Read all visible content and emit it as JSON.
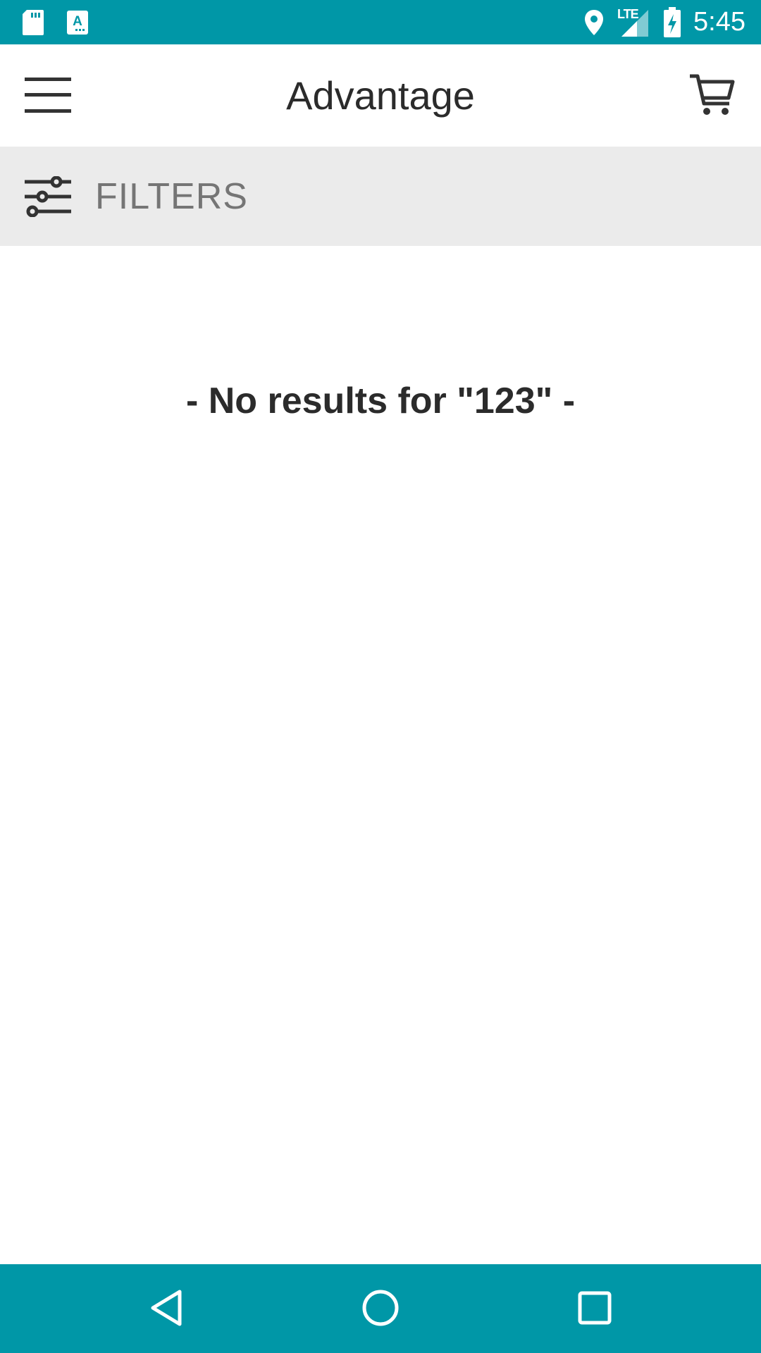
{
  "status_bar": {
    "time": "5:45",
    "network_label": "LTE",
    "icons": [
      "sd-card-icon",
      "text-notification-icon",
      "location-icon",
      "signal-icon",
      "battery-charging-icon"
    ]
  },
  "app_bar": {
    "title": "Advantage",
    "menu_icon": "hamburger-menu-icon",
    "cart_icon": "cart-icon"
  },
  "filters": {
    "label": "FILTERS",
    "icon": "sliders-icon"
  },
  "search_results": {
    "message": "- No results for \"123\" -"
  },
  "nav_bar": {
    "icons": [
      "back-icon",
      "home-icon",
      "recents-icon"
    ]
  },
  "colors": {
    "primary": "#0097a7",
    "filters_background": "#ebebeb",
    "text_dark": "#2b2b2b",
    "text_muted": "#757575"
  }
}
